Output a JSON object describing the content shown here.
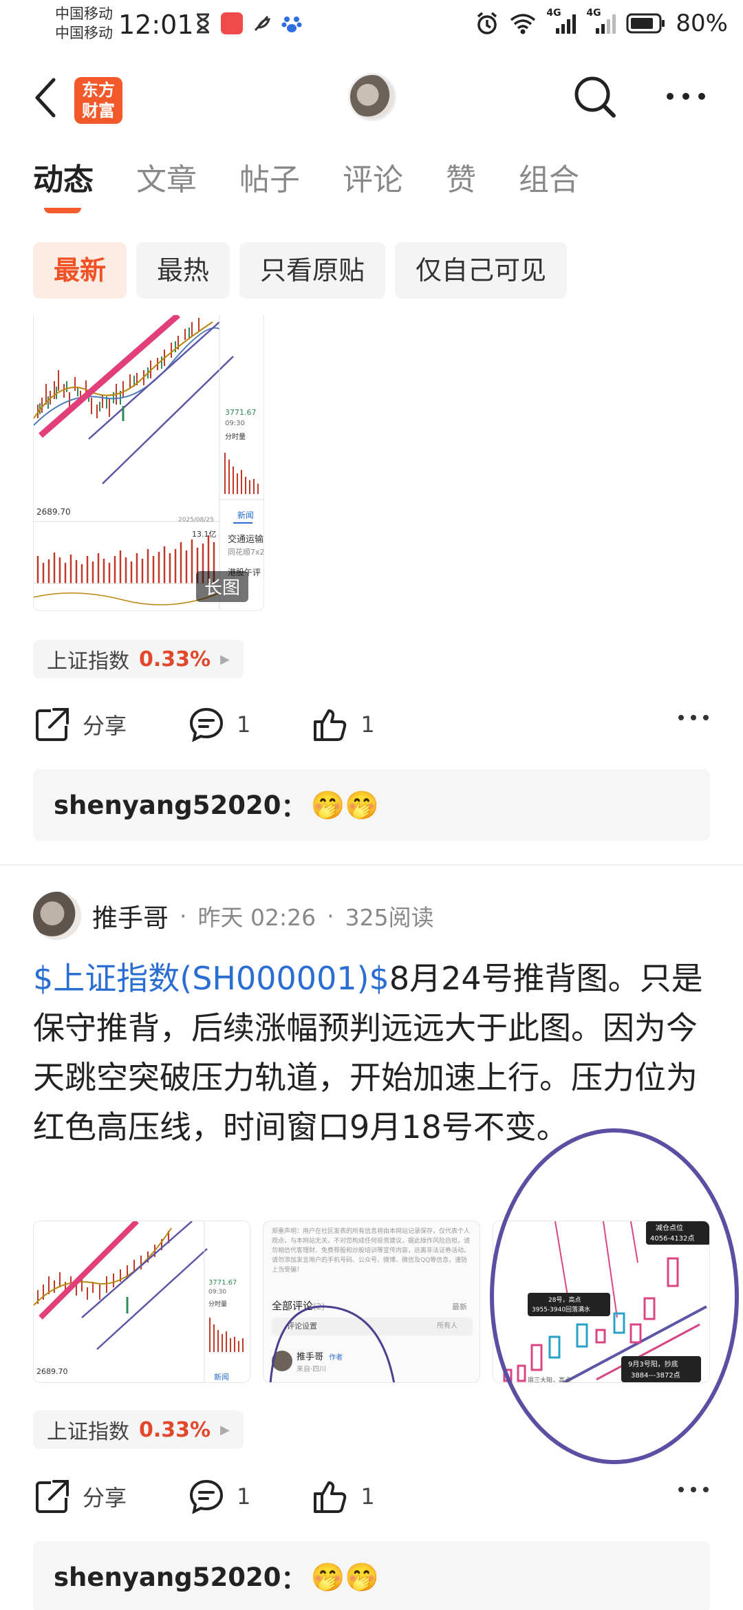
{
  "status_bar": {
    "carrier1": "中国移动",
    "carrier2": "中国移动",
    "time": "12:01",
    "network1": "4G",
    "network2": "4G",
    "battery": "80%"
  },
  "navbar": {
    "brand_line1": "东方",
    "brand_line2": "财富"
  },
  "tabs": [
    {
      "label": "动态",
      "active": true
    },
    {
      "label": "文章"
    },
    {
      "label": "帖子"
    },
    {
      "label": "评论"
    },
    {
      "label": "赞"
    },
    {
      "label": "组合"
    }
  ],
  "filters": [
    {
      "label": "最新",
      "active": true
    },
    {
      "label": "最热"
    },
    {
      "label": "只看原贴"
    },
    {
      "label": "仅自己可见"
    }
  ],
  "post1": {
    "image_label": "长图",
    "chart_texts": {
      "price": "3771.67",
      "time": "09:30",
      "volume_label": "分时量",
      "low": "2689.70",
      "date": "2025/08/25",
      "vol": "13.1亿",
      "news": "新闻",
      "news_item": "交通运输",
      "news_item2": "同花顺7x2",
      "news_item3": "港股午评"
    },
    "stock_name": "上证指数",
    "stock_change": "0.33%",
    "share_label": "分享",
    "comment_count": "1",
    "like_count": "1",
    "top_comment_user": "shenyang52020",
    "top_comment_emoji": "🤭🤭"
  },
  "post2": {
    "author": "推手哥",
    "time": "昨天 02:26",
    "reads": "325阅读",
    "stock_link": "$上证指数(SH000001)$",
    "body": "8月24号推背图。只是保守推背，后续涨幅预判远远大于此图。因为今天跳空突破压力轨道，开始加速上行。压力位为红色高压线，时间窗口9月18号不变。",
    "img1": {
      "price": "3771.67",
      "time": "09:30",
      "volume_label": "分时量",
      "low": "2689.70",
      "news": "新闻"
    },
    "img2": {
      "disclaimer": "郑重声明：用户在社区发表的所有信息将由本网站记录保存，仅代表个人观点，与本网站无关。不对您构成任何投资建议，据此操作风险自担。请勿相信代客理财、免费荐股和炒股培训等宣传内容，远离非法证券活动。请勿添加发言用户的手机号码、公众号、微博、微信及QQ等信息，谨防上当受骗！",
      "all_comments": "全部评论",
      "count": "(2)",
      "sort": "最新",
      "settings": "评论设置",
      "audience": "所有人",
      "commenter": "推手哥",
      "author_badge": "作者",
      "location": "来自·四川"
    },
    "img3": {
      "label1": "减仓点位",
      "label1b": "4056-4132点",
      "label2": "28号，高点",
      "label2b": "3955-3940回落满水",
      "label3": "9月3号阳，抄底",
      "label3b": "3884---3872点",
      "label4": "周三大阳，高点"
    },
    "stock_name": "上证指数",
    "stock_change": "0.33%",
    "share_label": "分享",
    "comment_count": "1",
    "like_count": "1",
    "top_comment_user": "shenyang52020",
    "top_comment_emoji": "🤭🤭"
  }
}
